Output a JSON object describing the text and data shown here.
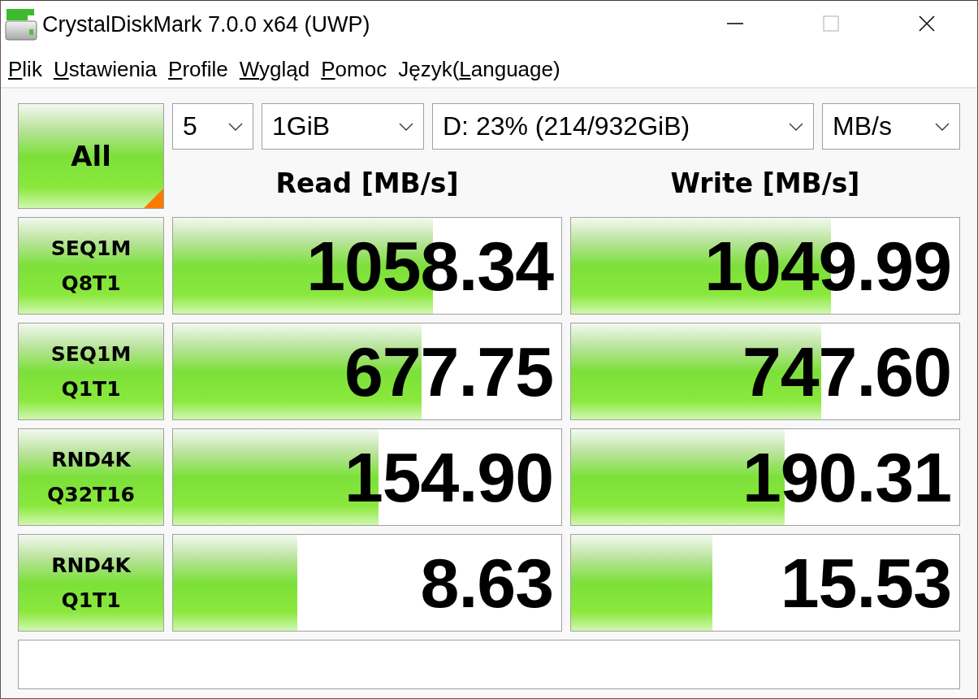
{
  "window": {
    "title": "CrystalDiskMark 7.0.0 x64 (UWP)"
  },
  "menu": [
    {
      "underlined": "P",
      "after": "lik"
    },
    {
      "underlined": "U",
      "after": "stawienia"
    },
    {
      "underlined": "P",
      "after": "rofile"
    },
    {
      "underlined": "W",
      "after": "ygląd"
    },
    {
      "underlined": "P",
      "after": "omoc"
    },
    {
      "before": "Język(",
      "underlined": "L",
      "after": "anguage)"
    }
  ],
  "all_button": {
    "label": "All"
  },
  "selectors": [
    {
      "kind": "count",
      "value": "5"
    },
    {
      "kind": "size",
      "value": "1GiB"
    },
    {
      "kind": "drive",
      "value": "D: 23% (214/932GiB)"
    },
    {
      "kind": "unit",
      "value": "MB/s"
    }
  ],
  "columns": [
    "Read [MB/s]",
    "Write [MB/s]"
  ],
  "tests": [
    {
      "line1": "SEQ1M",
      "line2": "Q8T1",
      "read": {
        "value": "1058.34",
        "level": 0.67
      },
      "write": {
        "value": "1049.99",
        "level": 0.67
      }
    },
    {
      "line1": "SEQ1M",
      "line2": "Q1T1",
      "read": {
        "value": "677.75",
        "level": 0.64
      },
      "write": {
        "value": "747.60",
        "level": 0.645
      }
    },
    {
      "line1": "RND4K",
      "line2": "Q32T16",
      "read": {
        "value": "154.90",
        "level": 0.53
      },
      "write": {
        "value": "190.31",
        "level": 0.55
      }
    },
    {
      "line1": "RND4K",
      "line2": "Q1T1",
      "read": {
        "value": "8.63",
        "level": 0.32
      },
      "write": {
        "value": "15.53",
        "level": 0.365
      }
    }
  ]
}
